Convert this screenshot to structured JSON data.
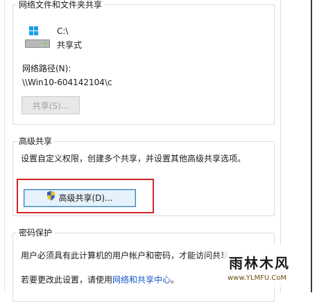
{
  "network_sharing": {
    "title": "网络文件和文件夹共享",
    "drive_name": "C:\\",
    "share_state": "共享式",
    "path_label": "网络路径(N):",
    "path_value": "\\\\Win10-604142104\\c",
    "share_button": "共享(S)..."
  },
  "advanced_sharing": {
    "title": "高级共享",
    "description": "设置自定义权限，创建多个共享，并设置其他高级共享选项。",
    "button": "高级共享(D)..."
  },
  "password_protection": {
    "title": "密码保护",
    "line1": "用户必须具有此计算机的用户帐户和密码，才能访问共享文件夹",
    "line2_prefix": "若要更改此设置，请使用",
    "line2_link": "网络和共享中心",
    "line2_suffix": "。"
  },
  "watermark": {
    "text": "雨林木风",
    "url": "www.YLMFU.CoM"
  },
  "colors": {
    "highlight": "#d3232a",
    "link": "#1556c7",
    "windows_blue": "#18a0e8"
  },
  "icons": {
    "drive": "drive-icon",
    "shield": "uac-shield-icon"
  }
}
